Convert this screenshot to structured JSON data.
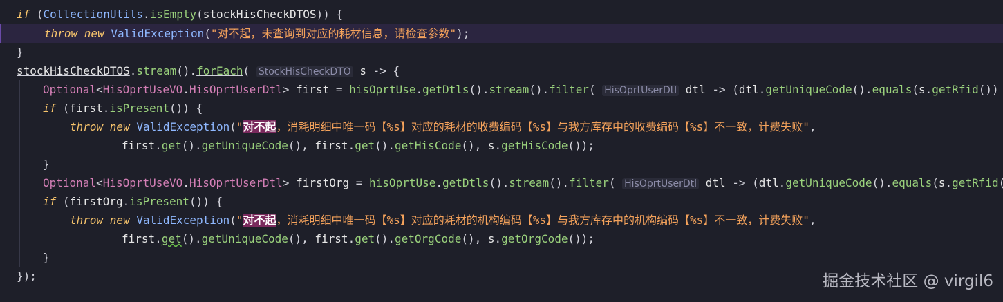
{
  "watermark": "掘金技术社区 @ virgil6",
  "lines": [
    {
      "tokens": [
        [
          "kw",
          "if"
        ],
        [
          "punc",
          " ("
        ],
        [
          "cls",
          "CollectionUtils"
        ],
        [
          "punc",
          "."
        ],
        [
          "fn",
          "isEmpty"
        ],
        [
          "punc",
          "("
        ],
        [
          "u",
          "stockHisCheckDTOS"
        ],
        [
          "punc",
          ")) {"
        ]
      ]
    },
    {
      "tokens": [
        [
          "kw",
          "throw new"
        ],
        [
          "punc",
          " "
        ],
        [
          "cls",
          "ValidException"
        ],
        [
          "punc",
          "("
        ],
        [
          "str",
          "\"对不起，未查询到对应的耗材信息，请检查参数\""
        ],
        [
          "punc",
          ");"
        ]
      ]
    },
    {
      "tokens": [
        [
          "punc",
          "}"
        ]
      ]
    },
    {
      "tokens": [
        [
          "u",
          "stockHisCheckDTOS"
        ],
        [
          "punc",
          "."
        ],
        [
          "fn",
          "stream"
        ],
        [
          "punc",
          "()."
        ],
        [
          "fnu",
          "forEach"
        ],
        [
          "punc",
          "( "
        ],
        [
          "hint",
          "StockHisCheckDTO"
        ],
        [
          "punc",
          " "
        ],
        [
          "var",
          "s"
        ],
        [
          "punc",
          " -> {"
        ]
      ]
    },
    {
      "tokens": [
        [
          "type",
          "Optional"
        ],
        [
          "punc",
          "<"
        ],
        [
          "type",
          "HisOprtUseVO"
        ],
        [
          "punc",
          "."
        ],
        [
          "type",
          "HisOprtUserDtl"
        ],
        [
          "punc",
          "> "
        ],
        [
          "var",
          "first"
        ],
        [
          "punc",
          " = "
        ],
        [
          "fn",
          "hisOprtUse"
        ],
        [
          "punc",
          "."
        ],
        [
          "fn",
          "getDtls"
        ],
        [
          "punc",
          "()."
        ],
        [
          "fn",
          "stream"
        ],
        [
          "punc",
          "()."
        ],
        [
          "fn",
          "filter"
        ],
        [
          "punc",
          "( "
        ],
        [
          "hint",
          "HisOprtUserDtl"
        ],
        [
          "punc",
          " "
        ],
        [
          "var",
          "dtl"
        ],
        [
          "punc",
          " -> ("
        ],
        [
          "var",
          "dtl"
        ],
        [
          "punc",
          "."
        ],
        [
          "fn",
          "getUniqueCode"
        ],
        [
          "punc",
          "()."
        ],
        [
          "fn",
          "equals"
        ],
        [
          "punc",
          "("
        ],
        [
          "var",
          "s"
        ],
        [
          "punc",
          "."
        ],
        [
          "fn",
          "getRfid"
        ],
        [
          "punc",
          "()) ||"
        ]
      ]
    },
    {
      "tokens": [
        [
          "kw",
          "if"
        ],
        [
          "punc",
          " ("
        ],
        [
          "var",
          "first"
        ],
        [
          "punc",
          "."
        ],
        [
          "fn",
          "isPresent"
        ],
        [
          "punc",
          "()) {"
        ]
      ]
    },
    {
      "tokens": [
        [
          "kw",
          "throw new"
        ],
        [
          "punc",
          " "
        ],
        [
          "cls",
          "ValidException"
        ],
        [
          "punc",
          "("
        ],
        [
          "str",
          "\""
        ],
        [
          "sel",
          "对不起"
        ],
        [
          "str",
          "，消耗明细中唯一码【%s】对应的耗材的收费编码【%s】与我方库存中的收费编码【%s】不一致，计费失败\""
        ],
        [
          "punc",
          ","
        ]
      ]
    },
    {
      "tokens": [
        [
          "var",
          "first"
        ],
        [
          "punc",
          "."
        ],
        [
          "fn",
          "get"
        ],
        [
          "punc",
          "()."
        ],
        [
          "fn",
          "getUniqueCode"
        ],
        [
          "punc",
          "(), "
        ],
        [
          "var",
          "first"
        ],
        [
          "punc",
          "."
        ],
        [
          "fn",
          "get"
        ],
        [
          "punc",
          "()."
        ],
        [
          "fn",
          "getHisCode"
        ],
        [
          "punc",
          "(), "
        ],
        [
          "var",
          "s"
        ],
        [
          "punc",
          "."
        ],
        [
          "fn",
          "getHisCode"
        ],
        [
          "punc",
          "());"
        ]
      ]
    },
    {
      "tokens": [
        [
          "punc",
          "}"
        ]
      ]
    },
    {
      "tokens": [
        [
          "type",
          "Optional"
        ],
        [
          "punc",
          "<"
        ],
        [
          "type",
          "HisOprtUseVO"
        ],
        [
          "punc",
          "."
        ],
        [
          "type",
          "HisOprtUserDtl"
        ],
        [
          "punc",
          "> "
        ],
        [
          "var",
          "firstOrg"
        ],
        [
          "punc",
          " = "
        ],
        [
          "fn",
          "hisOprtUse"
        ],
        [
          "punc",
          "."
        ],
        [
          "fn",
          "getDtls"
        ],
        [
          "punc",
          "()."
        ],
        [
          "fn",
          "stream"
        ],
        [
          "punc",
          "()."
        ],
        [
          "fn",
          "filter"
        ],
        [
          "punc",
          "( "
        ],
        [
          "hint",
          "HisOprtUserDtl"
        ],
        [
          "punc",
          " "
        ],
        [
          "var",
          "dtl"
        ],
        [
          "punc",
          " -> ("
        ],
        [
          "var",
          "dtl"
        ],
        [
          "punc",
          "."
        ],
        [
          "fn",
          "getUniqueCode"
        ],
        [
          "punc",
          "()."
        ],
        [
          "fn",
          "equals"
        ],
        [
          "punc",
          "("
        ],
        [
          "var",
          "s"
        ],
        [
          "punc",
          "."
        ],
        [
          "fn",
          "getRfid"
        ],
        [
          "punc",
          "())"
        ]
      ]
    },
    {
      "tokens": [
        [
          "kw",
          "if"
        ],
        [
          "punc",
          " ("
        ],
        [
          "var",
          "firstOrg"
        ],
        [
          "punc",
          "."
        ],
        [
          "fn",
          "isPresent"
        ],
        [
          "punc",
          "()) {"
        ]
      ]
    },
    {
      "tokens": [
        [
          "kw",
          "throw new"
        ],
        [
          "punc",
          " "
        ],
        [
          "cls",
          "ValidException"
        ],
        [
          "punc",
          "("
        ],
        [
          "str",
          "\""
        ],
        [
          "sel",
          "对不起"
        ],
        [
          "str",
          "，消耗明细中唯一码【%s】对应的耗材的机构编码【%s】与我方库存中的机构编码【%s】不一致，计费失败\""
        ],
        [
          "punc",
          ","
        ]
      ]
    },
    {
      "tokens": [
        [
          "var",
          "first"
        ],
        [
          "punc",
          "."
        ],
        [
          "fnw",
          "get"
        ],
        [
          "punc",
          "()."
        ],
        [
          "fn",
          "getUniqueCode"
        ],
        [
          "punc",
          "(), "
        ],
        [
          "var",
          "first"
        ],
        [
          "punc",
          "."
        ],
        [
          "fn",
          "get"
        ],
        [
          "punc",
          "()."
        ],
        [
          "fn",
          "getOrgCode"
        ],
        [
          "punc",
          "(), "
        ],
        [
          "var",
          "s"
        ],
        [
          "punc",
          "."
        ],
        [
          "fn",
          "getOrgCode"
        ],
        [
          "punc",
          "());"
        ]
      ]
    },
    {
      "tokens": [
        [
          "punc",
          "}"
        ]
      ]
    },
    {
      "tokens": [
        [
          "punc",
          "});"
        ]
      ]
    }
  ]
}
